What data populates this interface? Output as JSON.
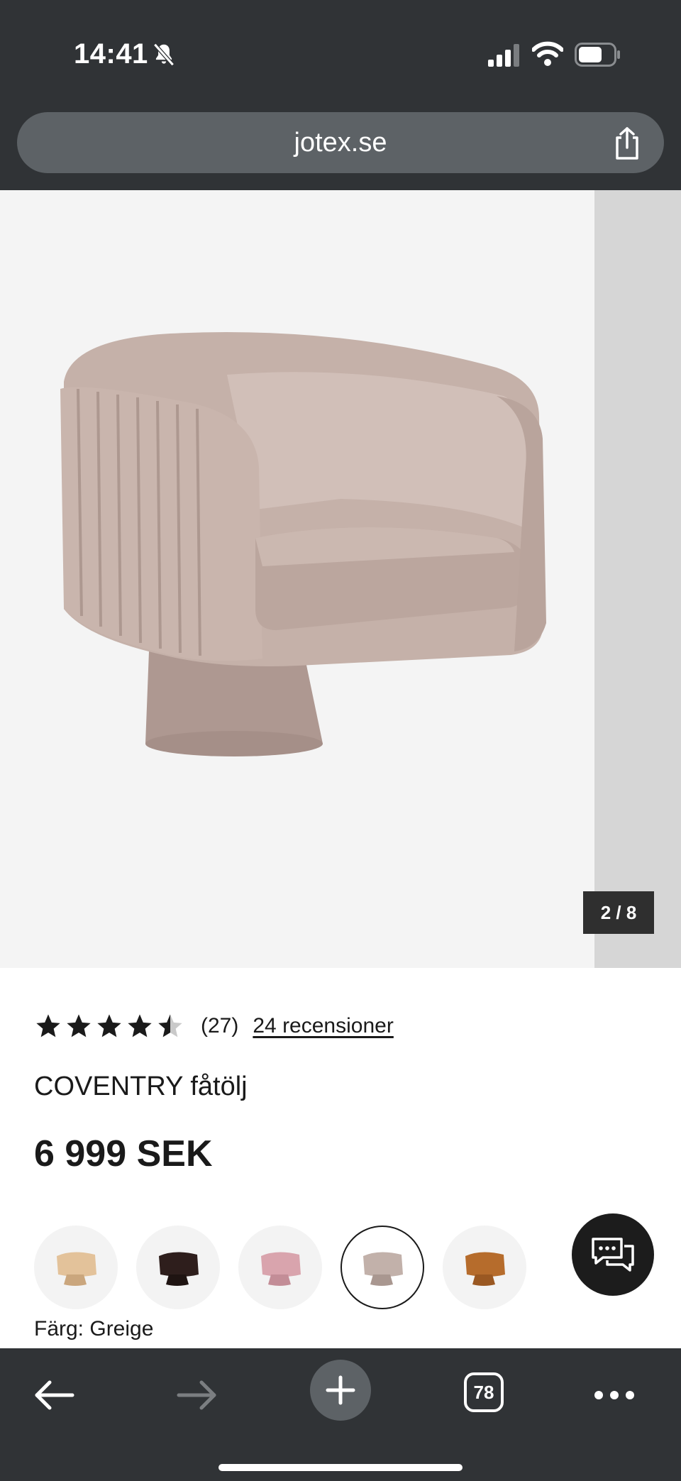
{
  "status_bar": {
    "time": "14:41",
    "icons": [
      "bell-slash-icon",
      "cellular-signal-icon",
      "wifi-icon",
      "battery-icon"
    ]
  },
  "browser": {
    "url": "jotex.se",
    "share_icon": "share-icon",
    "toolbar": {
      "back_icon": "back-arrow-icon",
      "forward_icon": "forward-arrow-icon",
      "new_tab_icon": "plus-icon",
      "tab_count": "78",
      "more_icon": "ellipsis-icon"
    }
  },
  "gallery": {
    "counter": "2 / 8",
    "current_image": 2,
    "total_images": 8
  },
  "product": {
    "rating_value": 4.5,
    "rating_max": 5,
    "rating_count": "(27)",
    "reviews_link": "24 recensioner",
    "name": "COVENTRY fåtölj",
    "price": "6 999 SEK",
    "color_label": "Färg: Greige",
    "swatches": [
      {
        "name": "beige",
        "color": "#e3c29a",
        "selected": false
      },
      {
        "name": "dark-brown",
        "color": "#2e1e1c",
        "selected": false
      },
      {
        "name": "pink",
        "color": "#d9a4ad",
        "selected": false
      },
      {
        "name": "greige",
        "color": "#c2b1aa",
        "selected": true
      },
      {
        "name": "cognac",
        "color": "#b66c2c",
        "selected": false
      }
    ]
  },
  "chat": {
    "icon": "chat-bubbles-icon"
  },
  "colors": {
    "chrome_dark": "#303336",
    "chrome_pill": "#5d6266",
    "gallery_bg": "#f4f4f4",
    "chair_fabric": "#c4b0a8",
    "text": "#1a1a1a"
  }
}
